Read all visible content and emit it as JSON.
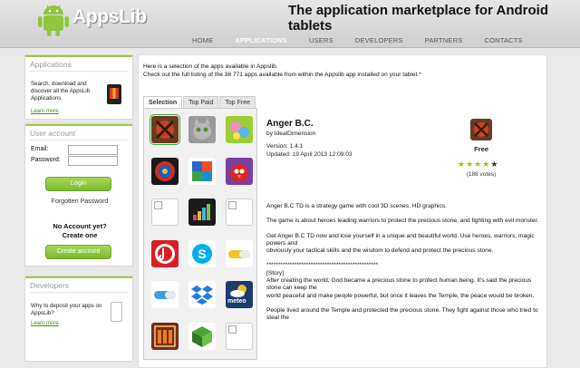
{
  "brand": {
    "name": "AppsLib",
    "tagline": "The application marketplace for Android tablets"
  },
  "nav": [
    {
      "label": "HOME",
      "active": false
    },
    {
      "label": "APPLICATIONS",
      "active": true
    },
    {
      "label": "USERS",
      "active": false
    },
    {
      "label": "DEVELOPERS",
      "active": false
    },
    {
      "label": "PARTNERS",
      "active": false
    },
    {
      "label": "CONTACTS",
      "active": false
    }
  ],
  "sidebar": {
    "applications": {
      "title": "Applications",
      "description": "Search, download and discover all the AppsLib Applications.",
      "link": "Learn more"
    },
    "account": {
      "title": "User account",
      "email_label": "Email:",
      "password_label": "Password:",
      "login_button": "Login",
      "forgot": "Forgotten Password",
      "no_account_line1": "No Account yet?",
      "no_account_line2": "Create one",
      "create_button": "Create account"
    },
    "developers": {
      "title": "Developers",
      "description": "Why to deposit your apps on AppsLib?",
      "link": "Learn more"
    }
  },
  "main": {
    "intro_line1": "Here is a selection of the apps available in Appslib.",
    "intro_line2": "Check out the full listing of the 38 771 apps available from within the Appslib app installed on your tablet.*",
    "tabs": [
      {
        "label": "Selection",
        "active": true
      },
      {
        "label": "Top Paid",
        "active": false
      },
      {
        "label": "Top Free",
        "active": false
      }
    ],
    "app": {
      "title": "Anger B.C.",
      "developer": "by IdealDimension",
      "version": "Version: 1.4.1",
      "updated": "Updated: 19 April 2013 12:09:03",
      "price": "Free",
      "rating": 4,
      "reviews": "(186 votes)",
      "description": [
        "Anger B.C TD is a strategy game with cool 3D scenes, HD graphics.",
        "The game is about heroes leading warriors to protect the precious stone, and fighting with evil monster.",
        "Get Anger B.C TD now and lose yourself in a unique and beautiful world. Use heroes, warriors, magic powers and",
        "obviously your tactical skills and the wisdom to defend and protect the precious stone.",
        "************************************************",
        "[Story]",
        "After creating the world, God became a precious stone to protect human being. It's said the precious stone can keep the",
        "world peaceful and make people powerful, but once it leaves the Temple, the peace would be broken.",
        "People lived around the Temple and protected the precious stone. They fight against those who tried to steal the"
      ]
    },
    "tiles": [
      {
        "name": "anger-bc-app-icon",
        "bg": "#6b3a1f",
        "kind": "anger"
      },
      {
        "name": "talking-cat-app-icon",
        "bg": "#9a9a9a",
        "kind": "cat"
      },
      {
        "name": "bubble-app-icon",
        "bg": "#9bcf34",
        "kind": "bubble"
      },
      {
        "name": "spiral-game-app-icon",
        "bg": "#1a1a1a",
        "kind": "spiral"
      },
      {
        "name": "office-suite-app-icon",
        "bg": "#ffffff",
        "kind": "office"
      },
      {
        "name": "angry-birds-app-icon",
        "bg": "#7a3fa3",
        "kind": "birds"
      },
      {
        "name": "broken-image-icon",
        "kind": "blank"
      },
      {
        "name": "deezer-app-icon",
        "bg": "#1c1c1c",
        "kind": "deezer"
      },
      {
        "name": "broken-image-icon",
        "kind": "blank"
      },
      {
        "name": "music-app-icon",
        "bg": "#d91f26",
        "kind": "music"
      },
      {
        "name": "skype-app-icon",
        "bg": "#ffffff",
        "kind": "skype"
      },
      {
        "name": "pill-app-icon",
        "bg": "#ffffff",
        "kind": "pill-yellow"
      },
      {
        "name": "capsule-app-icon",
        "bg": "#ffffff",
        "kind": "pill-blue"
      },
      {
        "name": "dropbox-app-icon",
        "bg": "#ffffff",
        "kind": "dropbox"
      },
      {
        "name": "meteo-app-icon",
        "bg": "#1c3c70",
        "kind": "meteo",
        "label": "meteo"
      },
      {
        "name": "abacus-app-icon",
        "bg": "#7a2b14",
        "kind": "abacus"
      },
      {
        "name": "cube-game-app-icon",
        "bg": "#ffffff",
        "kind": "cube"
      },
      {
        "name": "broken-image-icon",
        "kind": "blank"
      }
    ]
  }
}
